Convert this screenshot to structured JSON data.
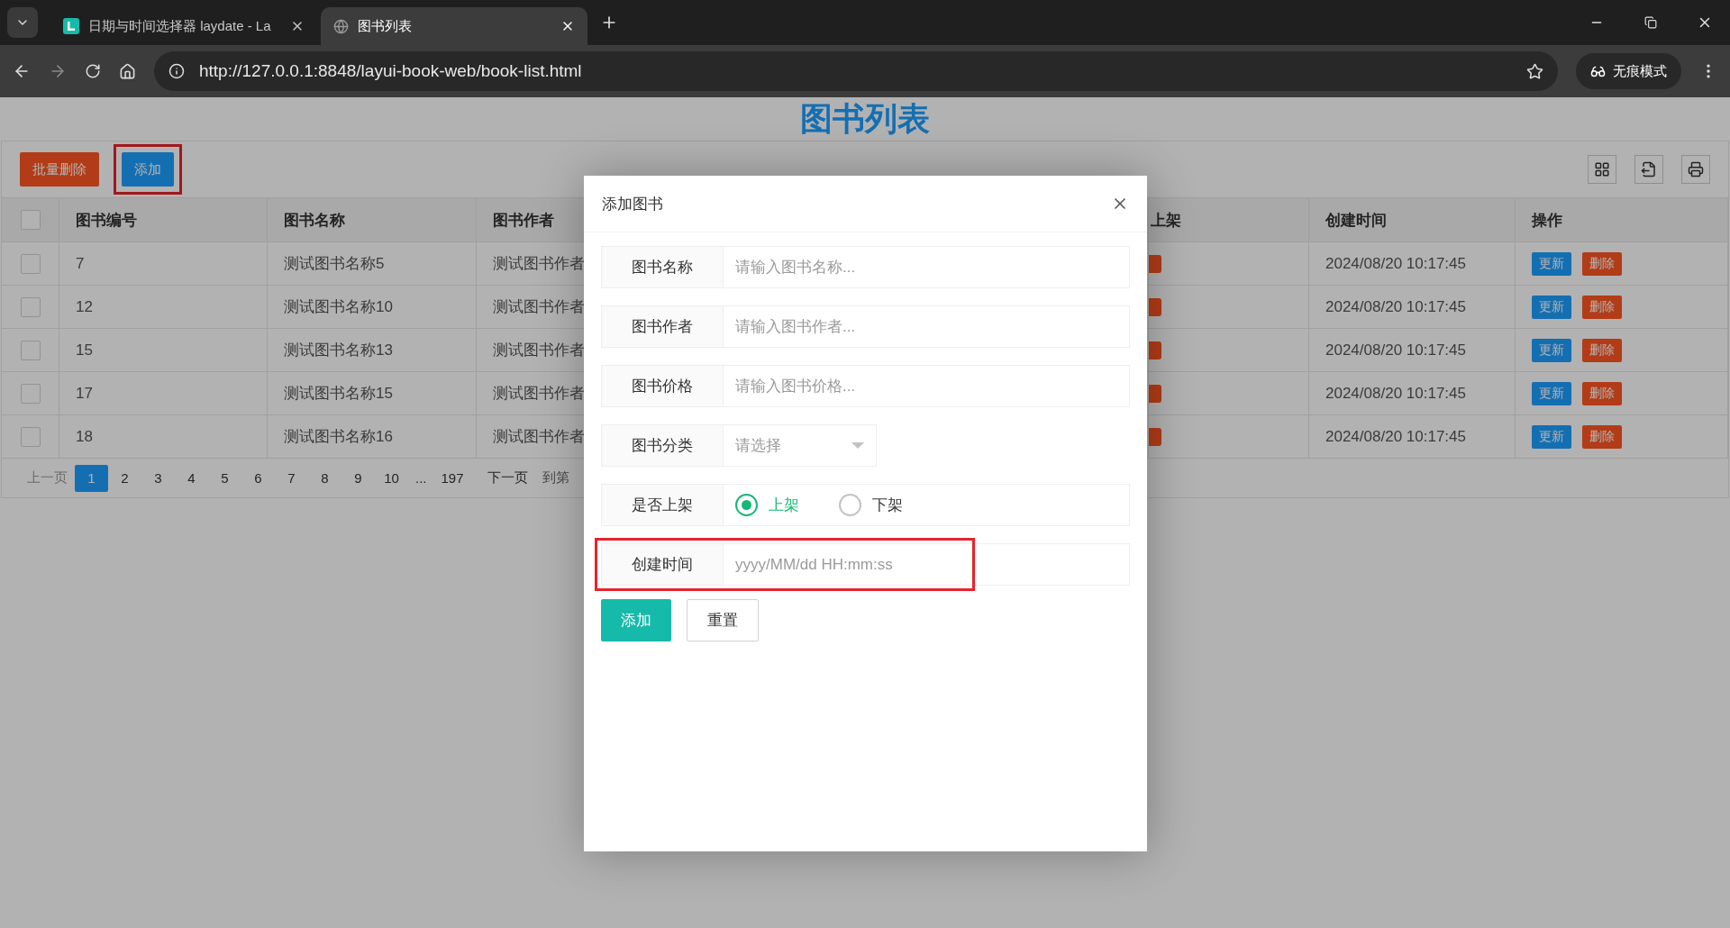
{
  "browser": {
    "tabs": [
      {
        "title": "日期与时间选择器 laydate - La",
        "selected": false
      },
      {
        "title": "图书列表",
        "selected": true
      }
    ],
    "url": "http://127.0.0.1:8848/layui-book-web/book-list.html",
    "incognito_label": "无痕模式"
  },
  "page": {
    "title": "图书列表",
    "toolbar": {
      "buttons": [
        {
          "label": "批量删除",
          "kind": "danger",
          "highlighted": false
        },
        {
          "label": "添加",
          "kind": "primary",
          "highlighted": true
        }
      ]
    },
    "table": {
      "select_all_checked": false,
      "columns": [
        "图书编号",
        "图书名称",
        "图书作者",
        "上架",
        "创建时间",
        "操作"
      ],
      "rows": [
        {
          "checked": false,
          "cells": [
            "7",
            "测试图书名称5",
            "测试图书作者",
            "2024/08/20 10:17:45"
          ],
          "actions": [
            "更新",
            "删除"
          ]
        },
        {
          "checked": false,
          "cells": [
            "12",
            "测试图书名称10",
            "测试图书作者",
            "2024/08/20 10:17:45"
          ],
          "actions": [
            "更新",
            "删除"
          ]
        },
        {
          "checked": false,
          "cells": [
            "15",
            "测试图书名称13",
            "测试图书作者",
            "2024/08/20 10:17:45"
          ],
          "actions": [
            "更新",
            "删除"
          ]
        },
        {
          "checked": false,
          "cells": [
            "17",
            "测试图书名称15",
            "测试图书作者",
            "2024/08/20 10:17:45"
          ],
          "actions": [
            "更新",
            "删除"
          ]
        },
        {
          "checked": false,
          "cells": [
            "18",
            "测试图书名称16",
            "测试图书作者",
            "2024/08/20 10:17:45"
          ],
          "actions": [
            "更新",
            "删除"
          ]
        }
      ]
    },
    "pagination": {
      "prev": {
        "label": "上一页",
        "disabled": true
      },
      "pages": [
        {
          "label": "1",
          "selected": true
        },
        {
          "label": "2",
          "selected": false
        },
        {
          "label": "3",
          "selected": false
        },
        {
          "label": "4",
          "selected": false
        },
        {
          "label": "5",
          "selected": false
        },
        {
          "label": "6",
          "selected": false
        },
        {
          "label": "7",
          "selected": false
        },
        {
          "label": "8",
          "selected": false
        },
        {
          "label": "9",
          "selected": false
        },
        {
          "label": "10",
          "selected": false
        }
      ],
      "ellipsis": "...",
      "last": "197",
      "next": {
        "label": "下一页",
        "disabled": false
      },
      "goto": "到第"
    }
  },
  "dialog": {
    "title": "添加图书",
    "fields": [
      {
        "kind": "text",
        "label": "图书名称",
        "placeholder": "请输入图书名称...",
        "highlighted": false
      },
      {
        "kind": "text",
        "label": "图书作者",
        "placeholder": "请输入图书作者...",
        "highlighted": false
      },
      {
        "kind": "text",
        "label": "图书价格",
        "placeholder": "请输入图书价格...",
        "highlighted": false
      },
      {
        "kind": "select",
        "label": "图书分类",
        "placeholder": "请选择",
        "highlighted": false
      },
      {
        "kind": "radio",
        "label": "是否上架",
        "highlighted": false,
        "options": [
          {
            "label": "上架",
            "selected": true
          },
          {
            "label": "下架",
            "selected": false
          }
        ]
      },
      {
        "kind": "date",
        "label": "创建时间",
        "placeholder": "yyyy/MM/dd HH:mm:ss",
        "highlighted": true
      }
    ],
    "buttons": [
      {
        "label": "添加",
        "kind": "primary"
      },
      {
        "label": "重置",
        "kind": "default"
      }
    ]
  }
}
